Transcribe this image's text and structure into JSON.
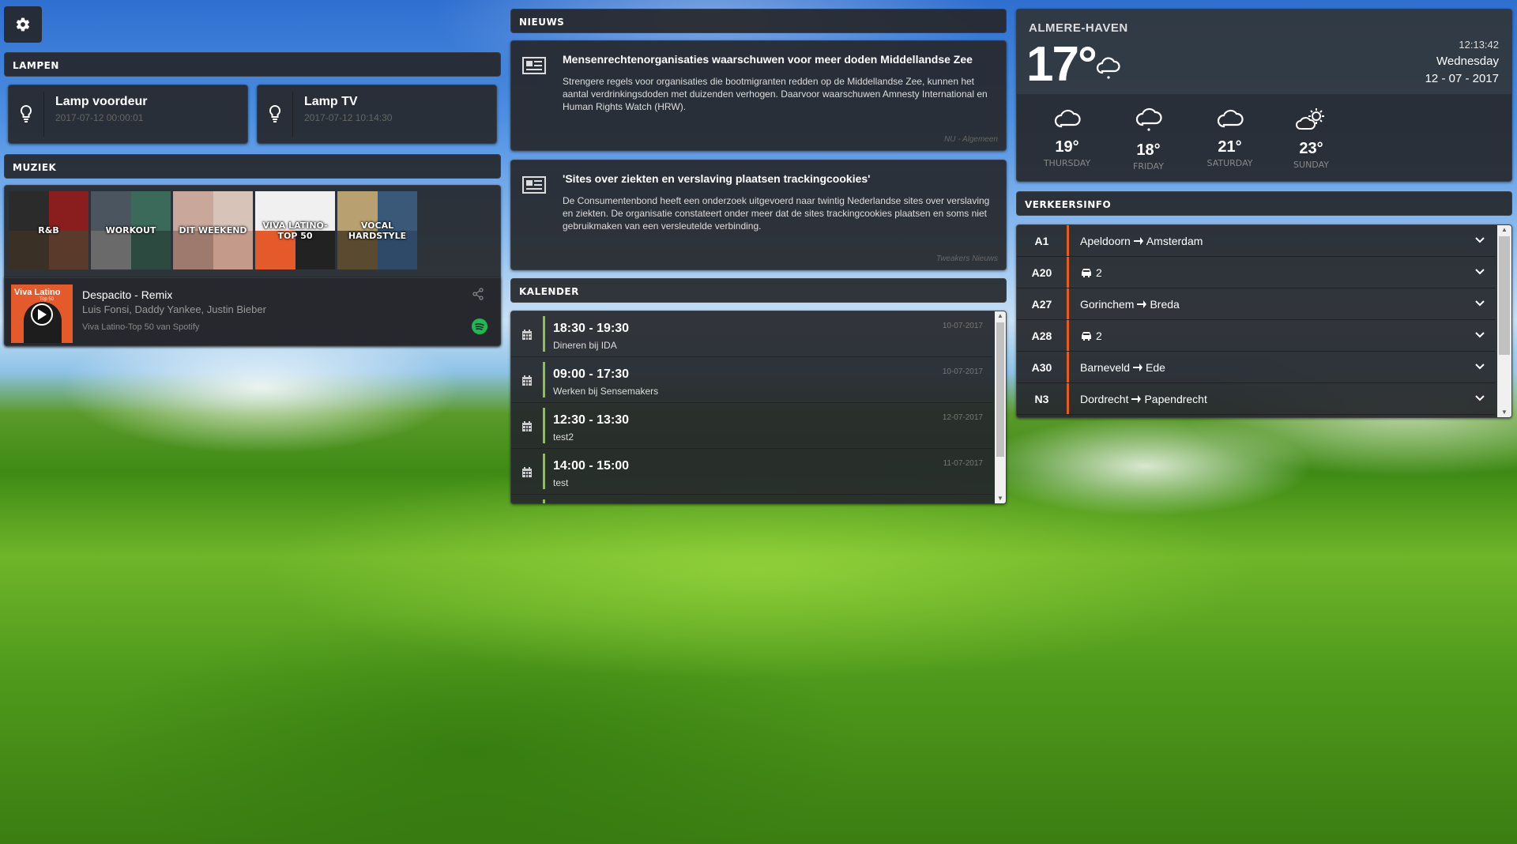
{
  "colors": {
    "accent_green": "#8bc34a",
    "traffic_orange": "#e65c1a",
    "spotify_green": "#1db954"
  },
  "toolbar": {
    "settings_icon": "gear-icon"
  },
  "lampen": {
    "header": "LAMPEN",
    "items": [
      {
        "name": "Lamp voordeur",
        "time": "2017-07-12 00:00:01",
        "icon": "lightbulb-icon"
      },
      {
        "name": "Lamp TV",
        "time": "2017-07-12 10:14:30",
        "icon": "lightbulb-icon"
      }
    ]
  },
  "muziek": {
    "header": "MUZIEK",
    "playlists": [
      {
        "label": "R&B"
      },
      {
        "label": "WORKOUT"
      },
      {
        "label": "DIT WEEKEND"
      },
      {
        "label": "VIVA LATINO-TOP 50"
      },
      {
        "label": "VOCAL HARDSTYLE"
      }
    ],
    "now_playing": {
      "title": "Despacito - Remix",
      "artists": "Luis Fonsi, Daddy Yankee, Justin Bieber",
      "source": "Viva Latino-Top 50 van Spotify",
      "cover_title": "Viva Latino",
      "cover_sub": "Top 50",
      "share_icon": "share-icon",
      "service_icon": "spotify-icon"
    }
  },
  "nieuws": {
    "header": "NIEUWS",
    "items": [
      {
        "title": "Mensenrechtenorganisaties waarschuwen voor meer doden Middellandse Zee",
        "body": "Strengere regels voor organisaties die bootmigranten redden op de Middellandse Zee, kunnen het aantal verdrinkingsdoden met duizenden verhogen. Daarvoor waarschuwen Amnesty International en Human Rights Watch (HRW).",
        "source": "NU - Algemeen"
      },
      {
        "title": "'Sites over ziekten en verslaving plaatsen trackingcookies'",
        "body": "De Consumentenbond heeft een onderzoek uitgevoerd naar twintig Nederlandse sites over verslaving en ziekten. De organisatie constateert onder meer dat de sites trackingcookies plaatsen en soms niet gebruikmaken van een versleutelde verbinding.",
        "source": "Tweakers Nieuws"
      }
    ]
  },
  "kalender": {
    "header": "KALENDER",
    "items": [
      {
        "time": "18:30 - 19:30",
        "title": "Dineren bij IDA",
        "date": "10-07-2017"
      },
      {
        "time": "09:00 - 17:30",
        "title": "Werken bij Sensemakers",
        "date": "10-07-2017"
      },
      {
        "time": "12:30 - 13:30",
        "title": "test2",
        "date": "12-07-2017"
      },
      {
        "time": "14:00 - 15:00",
        "title": "test",
        "date": "11-07-2017"
      }
    ]
  },
  "weer": {
    "city": "ALMERE-HAVEN",
    "temp": "17°",
    "clock": "12:13:42",
    "day": "Wednesday",
    "date": "12 - 07 - 2017",
    "forecast": [
      {
        "temp": "19°",
        "day": "THURSDAY",
        "icon": "cloud-icon"
      },
      {
        "temp": "18°",
        "day": "FRIDAY",
        "icon": "cloud-rain-icon"
      },
      {
        "temp": "21°",
        "day": "SATURDAY",
        "icon": "cloud-icon"
      },
      {
        "temp": "23°",
        "day": "SUNDAY",
        "icon": "partly-sunny-icon"
      }
    ]
  },
  "verkeer": {
    "header": "VERKEERSINFO",
    "items": [
      {
        "road": "A1",
        "from": "Apeldoorn",
        "to": "Amsterdam"
      },
      {
        "road": "A20",
        "count": "2"
      },
      {
        "road": "A27",
        "from": "Gorinchem",
        "to": "Breda"
      },
      {
        "road": "A28",
        "count": "2"
      },
      {
        "road": "A30",
        "from": "Barneveld",
        "to": "Ede"
      },
      {
        "road": "N3",
        "from": "Dordrecht",
        "to": "Papendrecht"
      }
    ]
  }
}
